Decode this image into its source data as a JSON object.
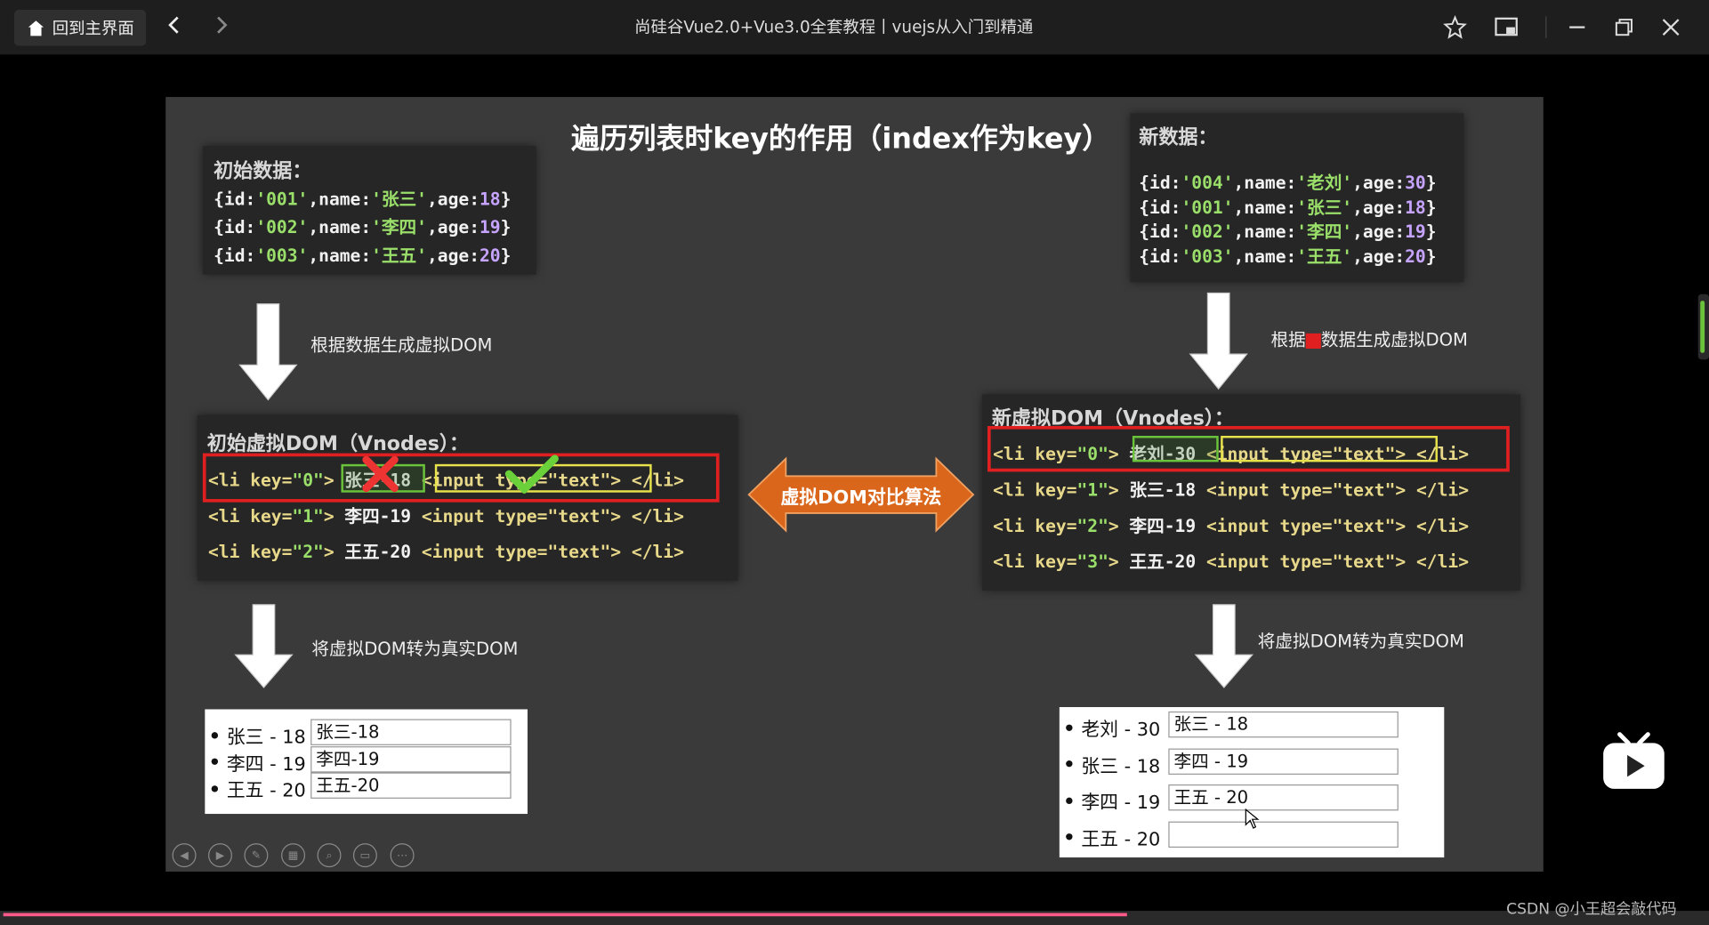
{
  "titlebar": {
    "home_label": "回到主界面",
    "title": "尚硅谷Vue2.0+Vue3.0全套教程丨vuejs从入门到精通"
  },
  "slide": {
    "title": "遍历列表时key的作用（index作为key）",
    "initial_data": {
      "title": "初始数据：",
      "rows": [
        {
          "id": "'001'",
          "name": "'张三'",
          "age": "18"
        },
        {
          "id": "'002'",
          "name": "'李四'",
          "age": "19"
        },
        {
          "id": "'003'",
          "name": "'王五'",
          "age": "20"
        }
      ]
    },
    "new_data": {
      "title": "新数据：",
      "rows": [
        {
          "id": "'004'",
          "name": "'老刘'",
          "age": "30"
        },
        {
          "id": "'001'",
          "name": "'张三'",
          "age": "18"
        },
        {
          "id": "'002'",
          "name": "'李四'",
          "age": "19"
        },
        {
          "id": "'003'",
          "name": "'王五'",
          "age": "20"
        }
      ]
    },
    "label_gen_left": "根据数据生成虚拟DOM",
    "label_gen_right_prefix": "根据",
    "label_gen_right_suffix": "数据生成虚拟DOM",
    "label_real_left": "将虚拟DOM转为真实DOM",
    "label_real_right": "将虚拟DOM转为真实DOM",
    "compare_label": "虚拟DOM对比算法",
    "initial_vdom": {
      "title": "初始虚拟DOM（Vnodes）：",
      "rows": [
        {
          "key": "0",
          "text": "张三-18"
        },
        {
          "key": "1",
          "text": "李四-19"
        },
        {
          "key": "2",
          "text": "王五-20"
        }
      ]
    },
    "new_vdom": {
      "title": "新虚拟DOM（Vnodes）：",
      "rows": [
        {
          "key": "0",
          "text": "老刘-30"
        },
        {
          "key": "1",
          "text": "张三-18"
        },
        {
          "key": "2",
          "text": "李四-19"
        },
        {
          "key": "3",
          "text": "王五-20"
        }
      ]
    },
    "input_tag": "<input type=\"text\">",
    "li_close": "</li>",
    "real_left": [
      {
        "label": "张三 - 18",
        "value": "张三-18"
      },
      {
        "label": "李四 - 19",
        "value": "李四-19"
      },
      {
        "label": "王五 - 20",
        "value": "王五-20"
      }
    ],
    "real_right": [
      {
        "label": "老刘 - 30",
        "value": "张三 - 18"
      },
      {
        "label": "张三 - 18",
        "value": "李四 - 19"
      },
      {
        "label": "李四 - 19",
        "value": "王五 - 20"
      },
      {
        "label": "王五 - 20",
        "value": ""
      }
    ]
  },
  "player": {
    "progress_percent": 66
  },
  "watermark": "CSDN @小王超会敲代码",
  "colors": {
    "red_highlight": "#e02020",
    "green_highlight": "#6bc23b",
    "yellow_highlight": "#e8e34a",
    "compare_arrow": "#d9661a"
  }
}
